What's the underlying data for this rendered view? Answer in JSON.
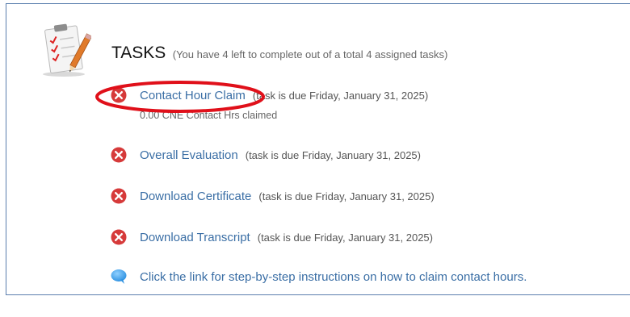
{
  "header": {
    "title": "TASKS",
    "subtitle": "(You have 4 left to complete out of a total 4 assigned tasks)"
  },
  "tasks": [
    {
      "label": "Contact Hour Claim",
      "due": "(task is due Friday, January 31, 2025)",
      "sub": "0.00 CNE Contact Hrs claimed",
      "icon": "x-circle-icon"
    },
    {
      "label": "Overall Evaluation",
      "due": "(task is due Friday, January 31, 2025)",
      "icon": "x-circle-icon"
    },
    {
      "label": "Download Certificate",
      "due": "(task is due Friday, January 31, 2025)",
      "icon": "x-circle-icon"
    },
    {
      "label": "Download Transcript",
      "due": "(task is due Friday, January 31, 2025)",
      "icon": "x-circle-icon"
    }
  ],
  "info": {
    "text": "Click the link for step-by-step instructions on how to claim contact hours.",
    "icon": "speech-bubble-icon"
  },
  "colors": {
    "link": "#3a6ea5",
    "x_icon": "#d63a3a",
    "highlight_oval": "#e0101a",
    "frame_border": "#5b7fae"
  }
}
